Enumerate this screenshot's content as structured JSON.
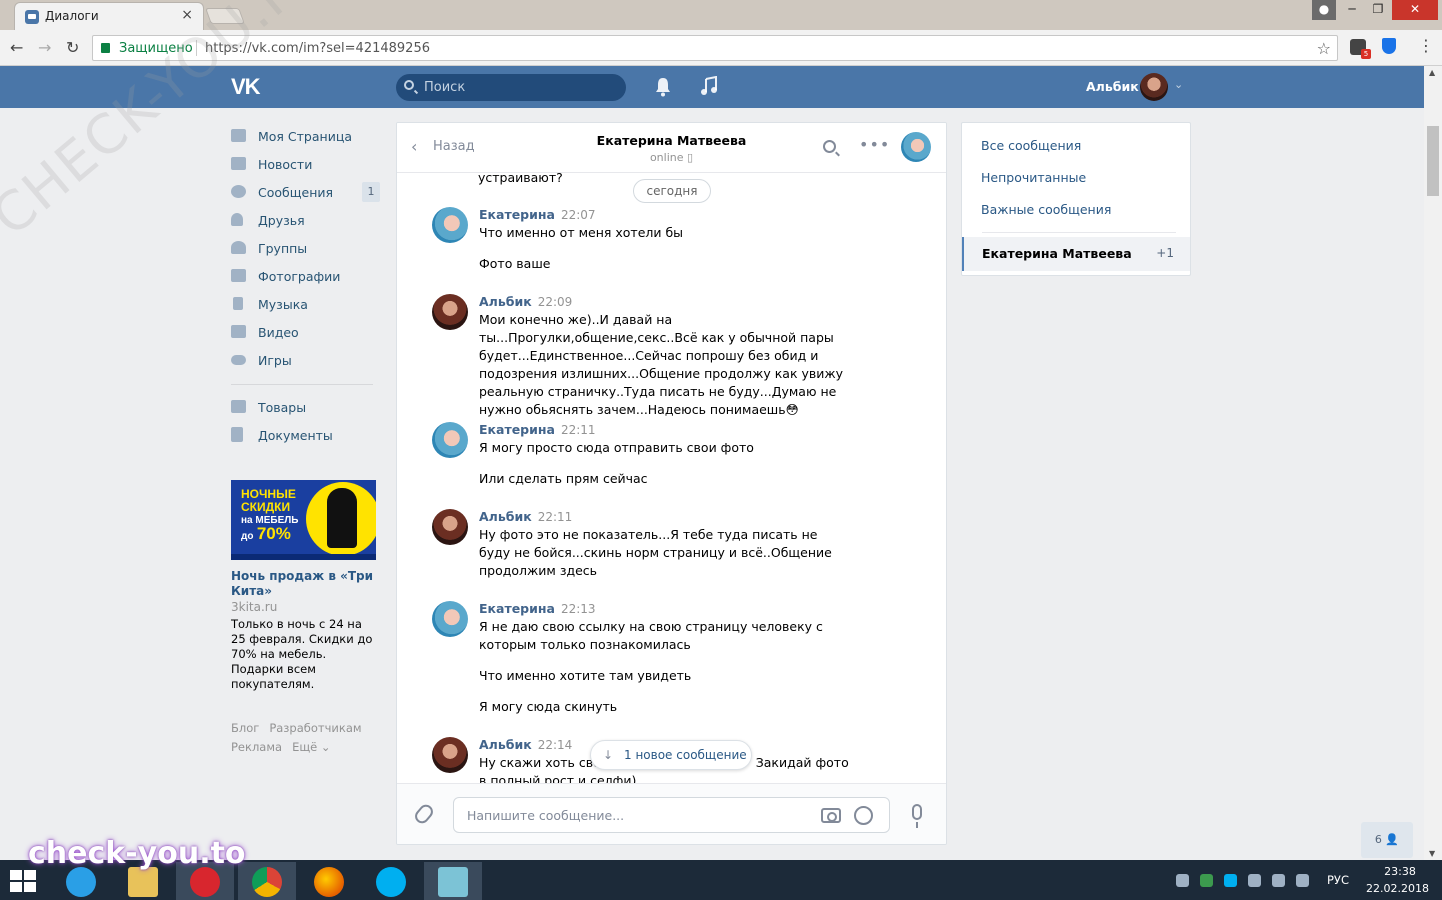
{
  "browser": {
    "tab_title": "Диалоги",
    "tab_close": "×",
    "secure_label": "Защищено",
    "url": "https://vk.com/im?sel=421489256",
    "ext_badge": "5"
  },
  "header": {
    "search_placeholder": "Поиск",
    "user_name": "Альбик"
  },
  "left_menu": {
    "items": [
      {
        "label": "Моя Страница",
        "icon": "home-icon"
      },
      {
        "label": "Новости",
        "icon": "news-icon"
      },
      {
        "label": "Сообщения",
        "icon": "messages-icon",
        "count": "1"
      },
      {
        "label": "Друзья",
        "icon": "friends-icon"
      },
      {
        "label": "Группы",
        "icon": "groups-icon"
      },
      {
        "label": "Фотографии",
        "icon": "photos-icon"
      },
      {
        "label": "Музыка",
        "icon": "music-icon"
      },
      {
        "label": "Видео",
        "icon": "video-icon"
      },
      {
        "label": "Игры",
        "icon": "games-icon"
      }
    ],
    "items2": [
      {
        "label": "Товары",
        "icon": "market-icon"
      },
      {
        "label": "Документы",
        "icon": "docs-icon"
      }
    ]
  },
  "ad": {
    "banner_line1": "НОЧНЫЕ",
    "banner_line2": "СКИДКИ",
    "banner_line3": "на МЕБЕЛЬ",
    "banner_line4_small": "до",
    "banner_line4_big": "70%",
    "title": "Ночь продаж в «Три Кита»",
    "domain": "3kita.ru",
    "description": "Только в ночь с 24 на 25 февраля. Скидки до 70% на мебель. Подарки всем покупателям."
  },
  "footer": {
    "links": [
      "Блог",
      "Разработчикам",
      "Реклама",
      "Ещё ⌄"
    ]
  },
  "chat": {
    "back_label": "Назад",
    "peer_name": "Екатерина Матвеева",
    "peer_status": "online ▯",
    "prev_text": "устраивают?",
    "date_divider": "сегодня",
    "groups": [
      {
        "author": "Екатерина",
        "time": "22:07",
        "avatar": "kat",
        "messages": [
          "Что именно от меня хотели бы",
          "Фото ваше"
        ]
      },
      {
        "author": "Альбик",
        "time": "22:09",
        "avatar": "alb",
        "messages": [
          "Мои конечно же)..И давай на ты...Прогулки,общение,секс..Всё как у обычной пары будет...Единственное...Сейчас попрошу без обид и подозрения излишних...Общение продолжу как увижу реальную страничку..Туда писать не буду...Думаю не нужно обьяснять зачем...Надеюсь понимаешь😳"
        ]
      },
      {
        "author": "Екатерина",
        "time": "22:11",
        "avatar": "kat",
        "messages": [
          "Я могу просто сюда отправить свои фото",
          "Или сделать прям сейчас"
        ]
      },
      {
        "author": "Альбик",
        "time": "22:11",
        "avatar": "alb",
        "messages": [
          "Ну фото это не показатель...Я тебе туда писать не буду не бойся...скинь норм страницу и всё..Общение продолжим здесь"
        ]
      },
      {
        "author": "Екатерина",
        "time": "22:13",
        "avatar": "kat",
        "messages": [
          "Я не даю свою ссылку на свою страницу человеку с которым только познакомилась",
          "Что именно хотите там увидеть",
          "Я могу сюда скинуть"
        ]
      },
      {
        "author": "Альбик",
        "time": "22:14",
        "avatar": "alb",
        "messages": [
          "Ну скажи хоть сво                                       Закидай фото в полный рост и селфи)"
        ]
      }
    ],
    "new_messages_label": "1 новое сообщение",
    "new_messages_arrow": "↓",
    "compose_placeholder": "Напишите сообщение..."
  },
  "right_panel": {
    "filters": [
      "Все сообщения",
      "Непрочитанные",
      "Важные сообщения"
    ],
    "active_dialog": "Екатерина Матвеева",
    "active_count": "+1"
  },
  "people_button": "6 👤",
  "taskbar": {
    "lang": "РУС",
    "time": "23:38",
    "date": "22.02.2018"
  },
  "watermarks": {
    "diagonal": "CHECK-YOU.ME",
    "bottom": "check-you.to"
  }
}
